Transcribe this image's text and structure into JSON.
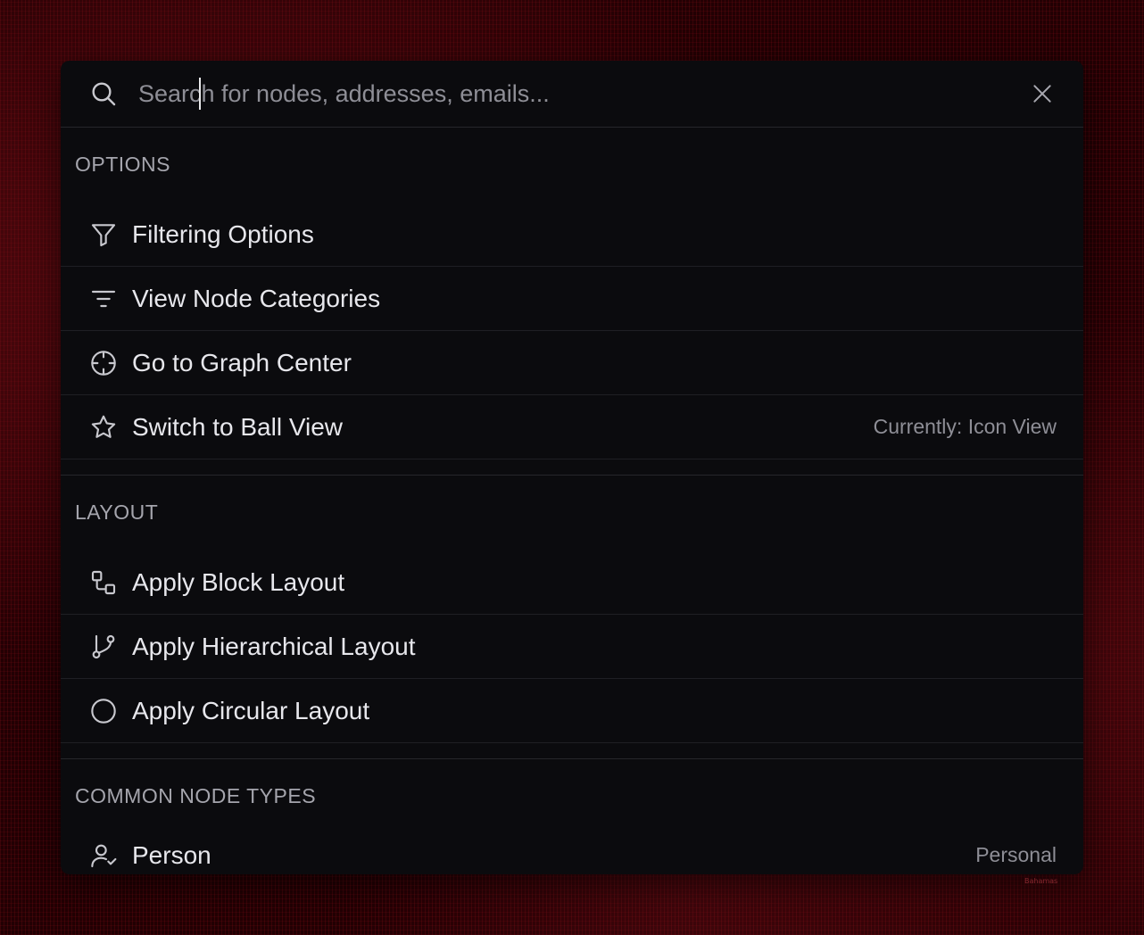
{
  "search": {
    "placeholder": "Search for nodes, addresses, emails..."
  },
  "background": {
    "map_label": "Bahamas"
  },
  "groups": [
    {
      "heading": "OPTIONS",
      "items": [
        {
          "label": "Filtering Options",
          "icon": "filter-icon",
          "meta": ""
        },
        {
          "label": "View Node Categories",
          "icon": "list-filter-icon",
          "meta": ""
        },
        {
          "label": "Go to Graph Center",
          "icon": "crosshair-icon",
          "meta": ""
        },
        {
          "label": "Switch to Ball View",
          "icon": "star-icon",
          "meta": "Currently: Icon View"
        }
      ]
    },
    {
      "heading": "LAYOUT",
      "items": [
        {
          "label": "Apply Block Layout",
          "icon": "blocks-icon",
          "meta": ""
        },
        {
          "label": "Apply Hierarchical Layout",
          "icon": "git-branch-icon",
          "meta": ""
        },
        {
          "label": "Apply Circular Layout",
          "icon": "circle-icon",
          "meta": ""
        }
      ]
    },
    {
      "heading": "COMMON NODE TYPES",
      "items": [
        {
          "label": "Person",
          "icon": "user-check-icon",
          "meta": "Personal"
        }
      ]
    }
  ],
  "colors": {
    "panel_bg": "#0b0b0e",
    "text": "#e7e7ec",
    "muted": "#8e8e96",
    "heading": "#a5a5ad",
    "backdrop": "#220003"
  }
}
